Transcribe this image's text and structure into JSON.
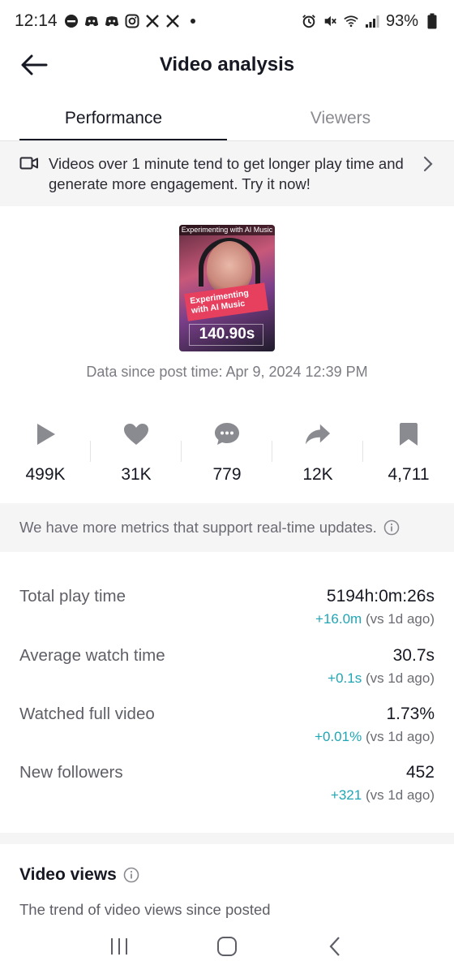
{
  "status_bar": {
    "time": "12:14",
    "battery": "93%",
    "notification_icons": [
      "do-not-disturb-icon",
      "discord-icon",
      "discord-icon",
      "instagram-icon",
      "x-icon",
      "x-icon",
      "dot-icon"
    ]
  },
  "header": {
    "title": "Video analysis"
  },
  "tabs": [
    {
      "label": "Performance",
      "active": true
    },
    {
      "label": "Viewers",
      "active": false
    }
  ],
  "banner": {
    "text": "Videos over 1 minute tend to get longer play time and generate more engagement. Try it now!"
  },
  "video": {
    "overlay_top": "Experimenting with AI Music",
    "overlay_title": "Experimenting with AI Music",
    "duration": "140.90s",
    "data_since": "Data since post time: Apr 9, 2024 12:39 PM"
  },
  "stats": [
    {
      "icon": "play-icon",
      "value": "499K"
    },
    {
      "icon": "heart-icon",
      "value": "31K"
    },
    {
      "icon": "comment-icon",
      "value": "779"
    },
    {
      "icon": "share-icon",
      "value": "12K"
    },
    {
      "icon": "bookmark-icon",
      "value": "4,711"
    }
  ],
  "realtime_note": "We have more metrics that support real-time updates.",
  "metrics": [
    {
      "label": "Total play time",
      "value": "5194h:0m:26s",
      "delta": "+16.0m",
      "delta_suffix": "(vs 1d ago)"
    },
    {
      "label": "Average watch time",
      "value": "30.7s",
      "delta": "+0.1s",
      "delta_suffix": "(vs 1d ago)"
    },
    {
      "label": "Watched full video",
      "value": "1.73%",
      "delta": "+0.01%",
      "delta_suffix": "(vs 1d ago)"
    },
    {
      "label": "New followers",
      "value": "452",
      "delta": "+321",
      "delta_suffix": "(vs 1d ago)"
    }
  ],
  "video_views": {
    "title": "Video views",
    "subtitle": "The trend of video views since posted"
  },
  "colors": {
    "accent_teal": "#20a5b5",
    "text_primary": "#161823",
    "bg_gray": "#f5f5f6"
  }
}
